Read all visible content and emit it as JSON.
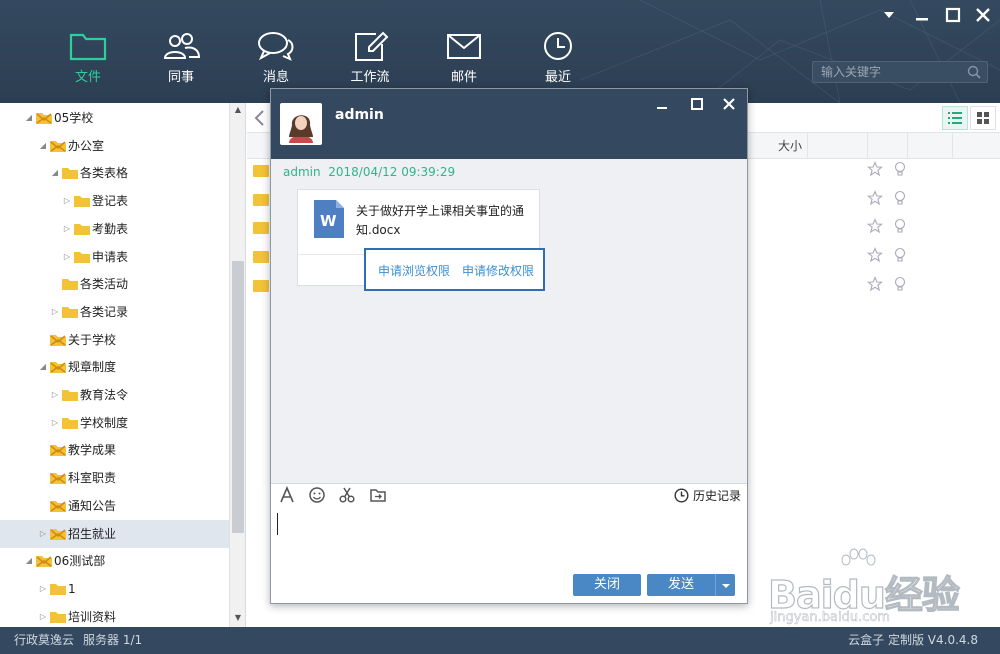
{
  "nav": {
    "items": [
      {
        "label": "文件",
        "icon": "folder-icon",
        "active": true
      },
      {
        "label": "同事",
        "icon": "colleagues-icon"
      },
      {
        "label": "消息",
        "icon": "message-icon"
      },
      {
        "label": "工作流",
        "icon": "workflow-icon"
      },
      {
        "label": "邮件",
        "icon": "mail-icon"
      },
      {
        "label": "最近",
        "icon": "clock-icon"
      }
    ]
  },
  "search": {
    "placeholder": "输入关键字"
  },
  "tree": {
    "items": [
      {
        "label": "05学校",
        "level": 1,
        "expanded": true,
        "type": "shared"
      },
      {
        "label": "办公室",
        "level": 2,
        "expanded": true,
        "type": "shared"
      },
      {
        "label": "各类表格",
        "level": 3,
        "expanded": true,
        "type": "folder"
      },
      {
        "label": "登记表",
        "level": 4,
        "expanded": false,
        "type": "folder"
      },
      {
        "label": "考勤表",
        "level": 4,
        "expanded": false,
        "type": "folder"
      },
      {
        "label": "申请表",
        "level": 4,
        "expanded": false,
        "type": "folder"
      },
      {
        "label": "各类活动",
        "level": 3,
        "expanded": null,
        "type": "folder"
      },
      {
        "label": "各类记录",
        "level": 3,
        "expanded": false,
        "type": "folder"
      },
      {
        "label": "关于学校",
        "level": 2,
        "expanded": null,
        "type": "shared"
      },
      {
        "label": "规章制度",
        "level": 2,
        "expanded": true,
        "type": "shared"
      },
      {
        "label": "教育法令",
        "level": 3,
        "expanded": false,
        "type": "folder"
      },
      {
        "label": "学校制度",
        "level": 3,
        "expanded": false,
        "type": "folder"
      },
      {
        "label": "教学成果",
        "level": 2,
        "expanded": null,
        "type": "shared"
      },
      {
        "label": "科室职责",
        "level": 2,
        "expanded": null,
        "type": "shared"
      },
      {
        "label": "通知公告",
        "level": 2,
        "expanded": null,
        "type": "shared"
      },
      {
        "label": "招生就业",
        "level": 2,
        "expanded": false,
        "type": "shared",
        "selected": true
      },
      {
        "label": "06测试部",
        "level": 1,
        "expanded": true,
        "type": "shared"
      },
      {
        "label": "1",
        "level": 2,
        "expanded": false,
        "type": "folder"
      },
      {
        "label": "培训资料",
        "level": 2,
        "expanded": false,
        "type": "folder"
      }
    ]
  },
  "filelist": {
    "column_size": "大小",
    "rows": 5
  },
  "dialog": {
    "title": "admin",
    "message": {
      "sender": "admin",
      "time": "2018/04/12 09:39:29",
      "file_name": "关于做好开学上课相关事宜的通知.docx",
      "file_icon": "word-doc-icon",
      "action_view": "申请浏览权限",
      "action_edit": "申请修改权限"
    },
    "history": "历史记录",
    "close_label": "关闭",
    "send_label": "发送"
  },
  "status": {
    "left": "行政莫逸云",
    "server": "服务器 1/1",
    "version": "云盒子 定制版 V4.0.4.8"
  },
  "watermark": {
    "text": "Baidu经验",
    "url": "jingyan.baidu.com"
  },
  "colors": {
    "header": "#34495f",
    "accent": "#2ecf9c",
    "button": "#4a87c5",
    "link": "#3a8fd4",
    "folder": "#f3c337"
  }
}
